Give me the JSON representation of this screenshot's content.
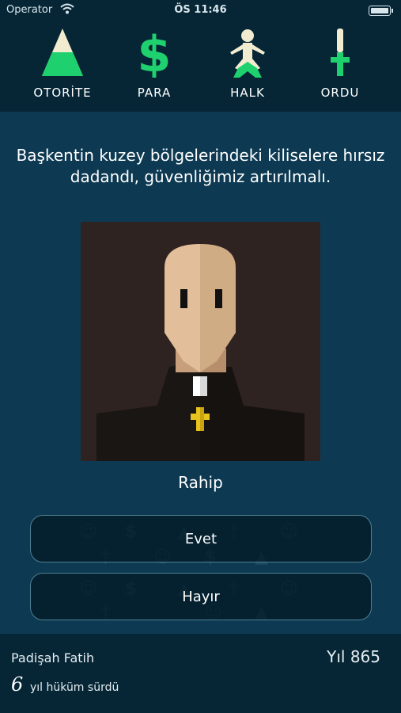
{
  "status_bar": {
    "carrier": "Operator",
    "time": "ÖS 11:46"
  },
  "stats": [
    {
      "label": "OTORİTE",
      "icon": "pyramid-icon",
      "level": 0.4
    },
    {
      "label": "PARA",
      "icon": "dollar-icon",
      "level": 1.0
    },
    {
      "label": "HALK",
      "icon": "person-icon",
      "level": 0.3
    },
    {
      "label": "ORDU",
      "icon": "sword-icon",
      "level": 0.55
    }
  ],
  "colors": {
    "header_bg": "#062636",
    "main_bg": "#0d3a52",
    "meter_fill": "#1fd06e",
    "meter_empty": "#f1ecd0",
    "button_border": "#4f7f91"
  },
  "card": {
    "question": "Başkentin kuzey bölgelerindeki kiliselere hırsız dadandı, güvenliğimiz artırılmalı.",
    "character": "Rahip",
    "portrait_icon": "priest-portrait"
  },
  "choices": {
    "yes": "Evet",
    "no": "Hayır"
  },
  "footer": {
    "ruler": "Padişah Fatih",
    "year": "Yıl 865",
    "reign_years": "6",
    "reign_label": "yıl hüküm sürdü"
  }
}
